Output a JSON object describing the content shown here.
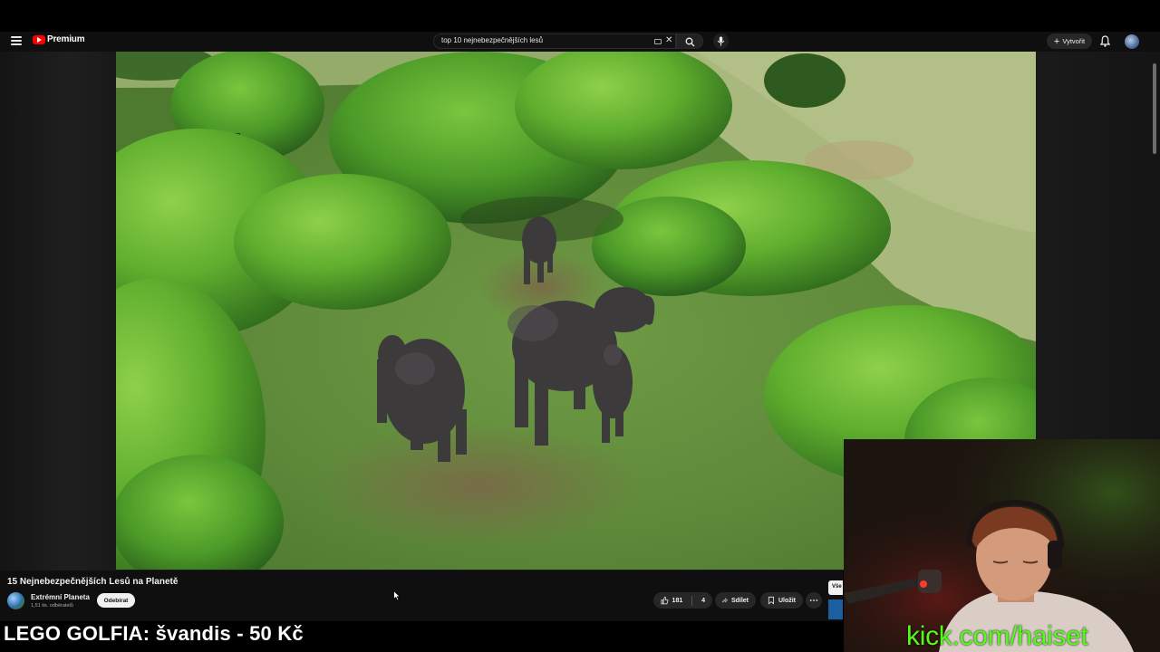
{
  "header": {
    "logo_text": "Premium",
    "search_value": "top 10 nejnebezpečnějších lesů",
    "create_label": "Vytvořit"
  },
  "video": {
    "title": "15 Nejnebezpečnějších Lesů na Planetě",
    "channel_name": "Extrémní Planeta",
    "subscribers": "1,51 tis. odběratelů",
    "subscribe_label": "Odebírat",
    "likes": "181",
    "comments": "4",
    "share_label": "Sdílet",
    "save_label": "Uložit",
    "side_label": "Vše"
  },
  "stream_overlay": {
    "ticker": "LEGO GOLFIA: švandis - 50 Kč",
    "kick_url": "kick.com/haiset"
  },
  "colors": {
    "accent_red": "#ff0000",
    "kick_green": "#53fc18",
    "bg": "#0f0f0f"
  }
}
